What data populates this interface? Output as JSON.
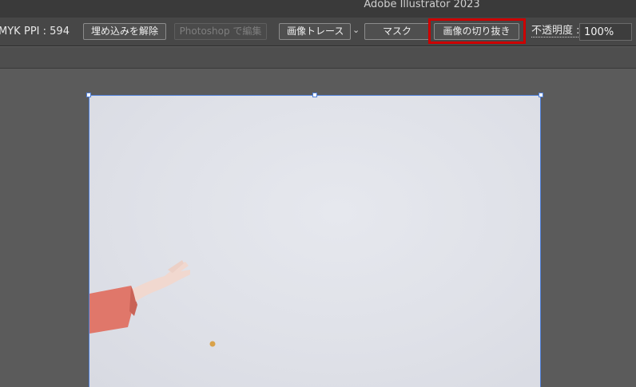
{
  "window": {
    "title": "Adobe Illustrator 2023"
  },
  "control_bar": {
    "color_mode_fragment": "MYK",
    "ppi_label": "PPI : 594",
    "unembed_button": "埋め込みを解除",
    "edit_photoshop_button": "Photoshop で編集",
    "image_trace_button": "画像トレース",
    "mask_button": "マスク",
    "crop_image_button": "画像の切り抜き",
    "opacity_label": "不透明度 :",
    "opacity_value": "100%"
  },
  "colors": {
    "highlight": "#cc0000",
    "selection": "#4f7fd8",
    "sleeve": "#e0776a"
  },
  "icons": {
    "trace_dropdown": "chevron-down-icon"
  }
}
